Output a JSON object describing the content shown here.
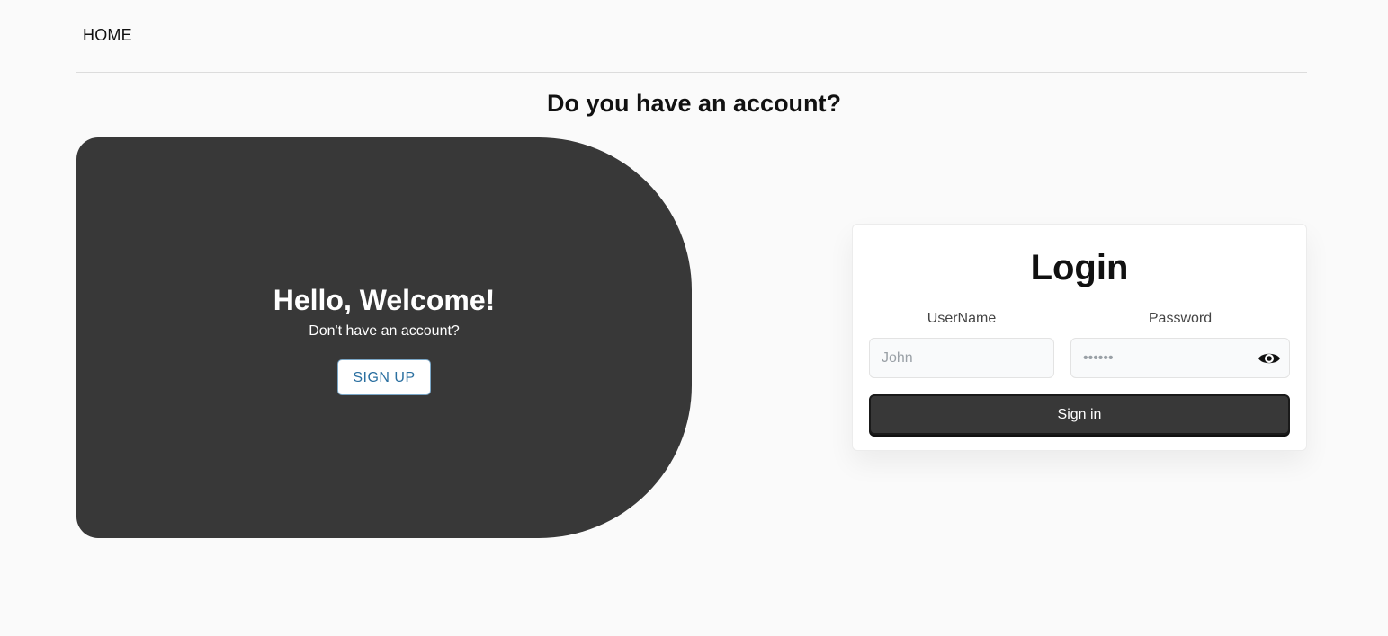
{
  "nav": {
    "home_label": "HOME"
  },
  "page": {
    "heading": "Do you have an account?"
  },
  "welcome": {
    "title": "Hello, Welcome!",
    "subtitle": "Don't have an account?",
    "signup_label": "SIGN UP",
    "panel_color": "#383838"
  },
  "login": {
    "title": "Login",
    "username_label": "UserName",
    "username_placeholder": "John",
    "password_label": "Password",
    "password_placeholder": "••••••",
    "toggle_icon": "eye-icon",
    "signin_label": "Sign in"
  }
}
